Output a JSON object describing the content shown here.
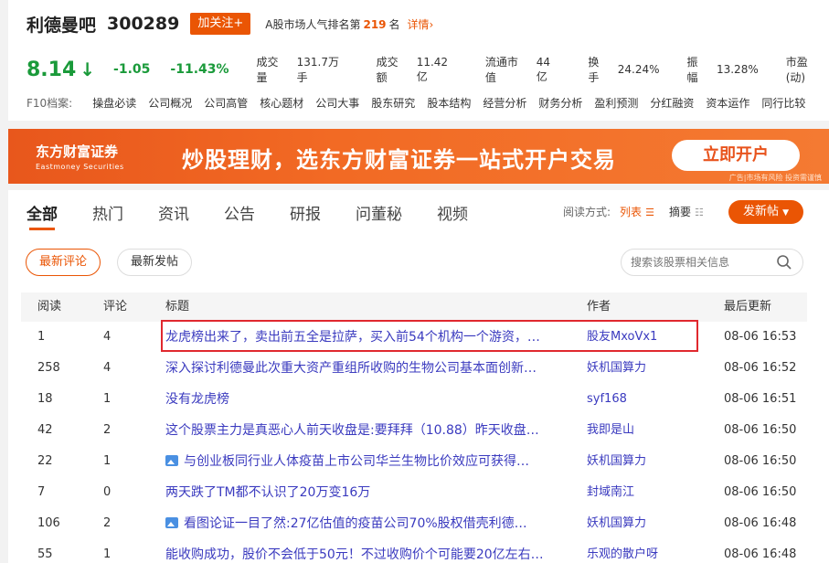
{
  "header": {
    "bar_name": "利德曼吧",
    "code": "300289",
    "follow_label": "加关注+",
    "rank_prefix": "A股市场人气排名第",
    "rank_value": "219",
    "rank_suffix": "名",
    "detail_label": "详情›"
  },
  "quote": {
    "price": "8.14",
    "arrow": "↓",
    "change": "-1.05",
    "change_pct": "-11.43%",
    "stats": [
      {
        "label": "成交量",
        "value": "131.7万手"
      },
      {
        "label": "成交额",
        "value": "11.42亿"
      },
      {
        "label": "流通市值",
        "value": "44亿"
      },
      {
        "label": "换手",
        "value": "24.24%"
      },
      {
        "label": "振幅",
        "value": "13.28%"
      },
      {
        "label": "市盈(动)",
        "value": ""
      }
    ],
    "colors": {
      "down": "#1a9a3a",
      "accent": "#ea5504"
    }
  },
  "f10": {
    "label": "F10档案:",
    "items": [
      "操盘必读",
      "公司概况",
      "公司高管",
      "核心题材",
      "公司大事",
      "股东研究",
      "股本结构",
      "经营分析",
      "财务分析",
      "盈利预测",
      "分红融资",
      "资本运作",
      "同行比较"
    ]
  },
  "banner": {
    "logo_main": "东方财富证券",
    "logo_sub": "Eastmoney Securities",
    "slogan": "炒股理财，选东方财富证券一站式开户交易",
    "button": "立即开户",
    "note": "广告|市场有风险 投资需谨慎"
  },
  "tabs": [
    "全部",
    "热门",
    "资讯",
    "公告",
    "研报",
    "问董秘",
    "视频"
  ],
  "view_mode": {
    "label": "阅读方式:",
    "list": "列表",
    "abstract": "摘要",
    "post_button": "发新帖"
  },
  "sort": {
    "latest_comment": "最新评论",
    "latest_post": "最新发帖"
  },
  "search": {
    "placeholder": "搜索该股票相关信息"
  },
  "table": {
    "headers": {
      "read": "阅读",
      "comment": "评论",
      "title": "标题",
      "author": "作者",
      "time": "最后更新"
    },
    "rows": [
      {
        "read": "1",
        "comment": "4",
        "title": "龙虎榜出来了，卖出前五全是拉萨，买入前54个机构一个游资，…",
        "author": "股友MxoVx1",
        "time": "08-06 16:53",
        "pic": false
      },
      {
        "read": "258",
        "comment": "4",
        "title": "深入探讨利德曼此次重大资产重组所收购的生物公司基本面创新…",
        "author": "妖机国算力",
        "time": "08-06 16:52",
        "pic": false
      },
      {
        "read": "18",
        "comment": "1",
        "title": "没有龙虎榜",
        "author": "syf168",
        "time": "08-06 16:51",
        "pic": false
      },
      {
        "read": "42",
        "comment": "2",
        "title": "这个股票主力是真恶心人前天收盘是:要拜拜（10.88）昨天收盘…",
        "author": "我即是山",
        "time": "08-06 16:50",
        "pic": false
      },
      {
        "read": "22",
        "comment": "1",
        "title": "与创业板同行业人体疫苗上市公司华兰生物比价效应可获得…",
        "author": "妖机国算力",
        "time": "08-06 16:50",
        "pic": true
      },
      {
        "read": "7",
        "comment": "0",
        "title": "两天跌了TM都不认识了20万变16万",
        "author": "封域南江",
        "time": "08-06 16:50",
        "pic": false
      },
      {
        "read": "106",
        "comment": "2",
        "title": "看图论证一目了然:27亿估值的疫苗公司70%股权借壳利德…",
        "author": "妖机国算力",
        "time": "08-06 16:48",
        "pic": true
      },
      {
        "read": "55",
        "comment": "1",
        "title": "能收购成功，股价不会低于50元！不过收购价个可能要20亿左右…",
        "author": "乐观的散户呀",
        "time": "08-06 16:48",
        "pic": false
      }
    ]
  }
}
